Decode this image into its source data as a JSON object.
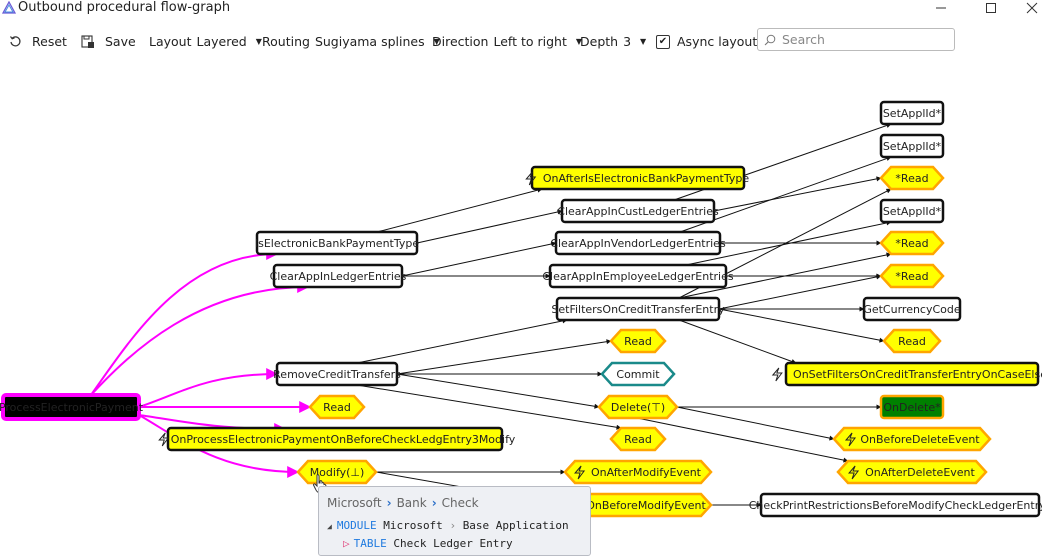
{
  "window": {
    "title": "Outbound procedural flow-graph",
    "controls": [
      "minimize",
      "maximize",
      "close"
    ]
  },
  "toolbar": {
    "reset_label": "Reset",
    "save_label": "Save",
    "layout_label": "Layout",
    "layout_value": "Layered",
    "routing_label": "Routing",
    "routing_value": "Sugiyama splines",
    "direction_label": "Direction",
    "direction_value": "Left to right",
    "depth_label": "Depth",
    "depth_value": "3",
    "async_label": "Async layout",
    "async_checked": true,
    "search_placeholder": "Search",
    "search_value": ""
  },
  "colors": {
    "root_edge": "#ff00ff",
    "edge": "#111111",
    "event_fill": "#ffff00",
    "hex_fill": "#ffff00",
    "hex_stroke": "#ffa500",
    "commit_stroke": "#1a8a8a",
    "commit_text": "#ff00ff",
    "trigger_fill": "#008000"
  },
  "graph": {
    "nodes": [
      {
        "id": "root",
        "label": "ProcessElectronicPayment",
        "kind": "root"
      },
      {
        "id": "isElec",
        "label": "IsElectronicBankPaymentType",
        "kind": "proc"
      },
      {
        "id": "clearLedger",
        "label": "ClearAppInLedgerEntries",
        "kind": "proc"
      },
      {
        "id": "removeCT",
        "label": "RemoveCreditTransfers",
        "kind": "proc"
      },
      {
        "id": "read1",
        "label": "Read",
        "kind": "op"
      },
      {
        "id": "onProcEvt",
        "label": "OnProcessElectronicPaymentOnBeforeCheckLedgEntry3Modify",
        "kind": "event"
      },
      {
        "id": "modify",
        "label": "Modify(⊥)",
        "kind": "op"
      },
      {
        "id": "onAfterIsElec",
        "label": "OnAfterIsElectronicBankPaymentType",
        "kind": "event"
      },
      {
        "id": "clearCust",
        "label": "ClearAppInCustLedgerEntries",
        "kind": "proc"
      },
      {
        "id": "clearVendor",
        "label": "ClearAppInVendorLedgerEntries",
        "kind": "proc"
      },
      {
        "id": "clearEmp",
        "label": "ClearAppInEmployeeLedgerEntries",
        "kind": "proc"
      },
      {
        "id": "setFilters",
        "label": "SetFiltersOnCreditTransferEntry",
        "kind": "proc"
      },
      {
        "id": "read2",
        "label": "Read",
        "kind": "op"
      },
      {
        "id": "commit",
        "label": "Commit",
        "kind": "commit"
      },
      {
        "id": "delete",
        "label": "Delete(⊤)",
        "kind": "op"
      },
      {
        "id": "read3",
        "label": "Read",
        "kind": "op"
      },
      {
        "id": "onAfterModify",
        "label": "OnAfterModifyEvent",
        "kind": "event-op"
      },
      {
        "id": "onBeforeModify",
        "label": "OnBeforeModifyEvent",
        "kind": "event-op"
      },
      {
        "id": "setAppl1",
        "label": "SetApplId*",
        "kind": "proc"
      },
      {
        "id": "setAppl2",
        "label": "SetApplId*",
        "kind": "proc"
      },
      {
        "id": "readS1",
        "label": "*Read",
        "kind": "op"
      },
      {
        "id": "setAppl3",
        "label": "SetApplId*",
        "kind": "proc"
      },
      {
        "id": "readS2",
        "label": "*Read",
        "kind": "op"
      },
      {
        "id": "readS3",
        "label": "*Read",
        "kind": "op"
      },
      {
        "id": "getCurrency",
        "label": "GetCurrencyCode",
        "kind": "proc"
      },
      {
        "id": "read4",
        "label": "Read",
        "kind": "op"
      },
      {
        "id": "onSetFilters",
        "label": "OnSetFiltersOnCreditTransferEntryOnCaseElse",
        "kind": "event"
      },
      {
        "id": "onDelete",
        "label": "OnDelete*",
        "kind": "trigger"
      },
      {
        "id": "onBeforeDelete",
        "label": "OnBeforeDeleteEvent",
        "kind": "event-op"
      },
      {
        "id": "onAfterDelete",
        "label": "OnAfterDeleteEvent",
        "kind": "event-op"
      },
      {
        "id": "checkPrint",
        "label": "CheckPrintRestrictionsBeforeModifyCheckLedgerEntry*",
        "kind": "proc"
      }
    ],
    "edges": [
      [
        "root",
        "isElec"
      ],
      [
        "root",
        "clearLedger"
      ],
      [
        "root",
        "removeCT"
      ],
      [
        "root",
        "read1"
      ],
      [
        "root",
        "onProcEvt"
      ],
      [
        "root",
        "modify"
      ],
      [
        "isElec",
        "onAfterIsElec"
      ],
      [
        "isElec",
        "clearCust"
      ],
      [
        "clearLedger",
        "clearVendor"
      ],
      [
        "clearLedger",
        "clearEmp"
      ],
      [
        "removeCT",
        "setFilters"
      ],
      [
        "removeCT",
        "read2"
      ],
      [
        "removeCT",
        "commit"
      ],
      [
        "removeCT",
        "delete"
      ],
      [
        "removeCT",
        "read3"
      ],
      [
        "modify",
        "onAfterModify"
      ],
      [
        "modify",
        "onBeforeModify"
      ],
      [
        "clearCust",
        "setAppl1"
      ],
      [
        "clearCust",
        "readS1"
      ],
      [
        "clearVendor",
        "setAppl2"
      ],
      [
        "clearVendor",
        "readS2"
      ],
      [
        "clearEmp",
        "setAppl3"
      ],
      [
        "clearEmp",
        "readS3"
      ],
      [
        "setFilters",
        "readS1"
      ],
      [
        "setFilters",
        "readS2"
      ],
      [
        "setFilters",
        "readS3"
      ],
      [
        "setFilters",
        "getCurrency"
      ],
      [
        "setFilters",
        "read4"
      ],
      [
        "setFilters",
        "onSetFilters"
      ],
      [
        "delete",
        "onDelete"
      ],
      [
        "delete",
        "onBeforeDelete"
      ],
      [
        "delete",
        "onAfterDelete"
      ],
      [
        "onBeforeModify",
        "checkPrint"
      ]
    ]
  },
  "tooltip": {
    "breadcrumb": [
      "Microsoft",
      "Bank",
      "Check"
    ],
    "module_kw": "MODULE",
    "module_path": [
      "Microsoft",
      "Base Application"
    ],
    "table_kw": "TABLE",
    "table_name": "Check Ledger Entry"
  }
}
